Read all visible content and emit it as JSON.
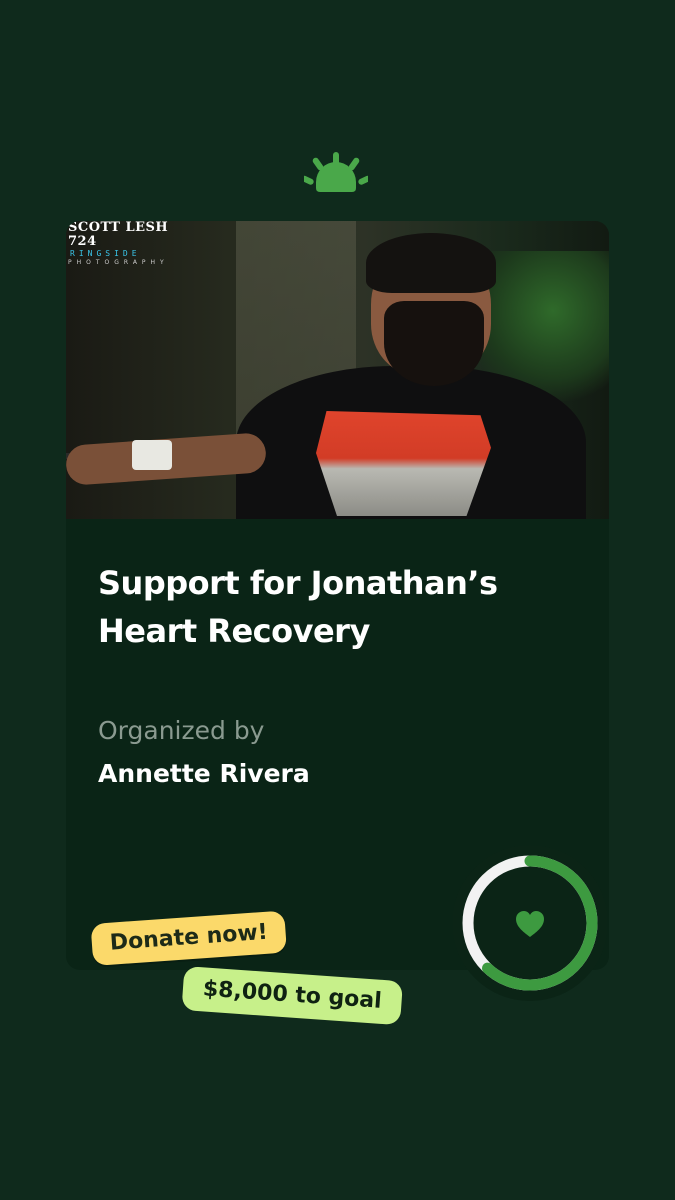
{
  "brand": {
    "logo_icon": "gofundme-sunrise-icon",
    "accent": "#4aa84a",
    "background": "#0f2a1c"
  },
  "campaign": {
    "photo_watermark": {
      "line1": "SCOTT LESH 724",
      "line2": "RINGSIDE",
      "line3": "PHOTOGRAPHY"
    },
    "title": "Support for Jonathan’s Heart Recovery",
    "organized_label": "Organized by",
    "organizer_name": "Annette Rivera"
  },
  "progress": {
    "fraction_raised": 0.62,
    "icon": "heart-icon",
    "ring_color": "#3d9a40",
    "track_color": "#f2f2f2"
  },
  "tags": {
    "donate": "Donate now!",
    "goal": "$8,000 to goal"
  }
}
